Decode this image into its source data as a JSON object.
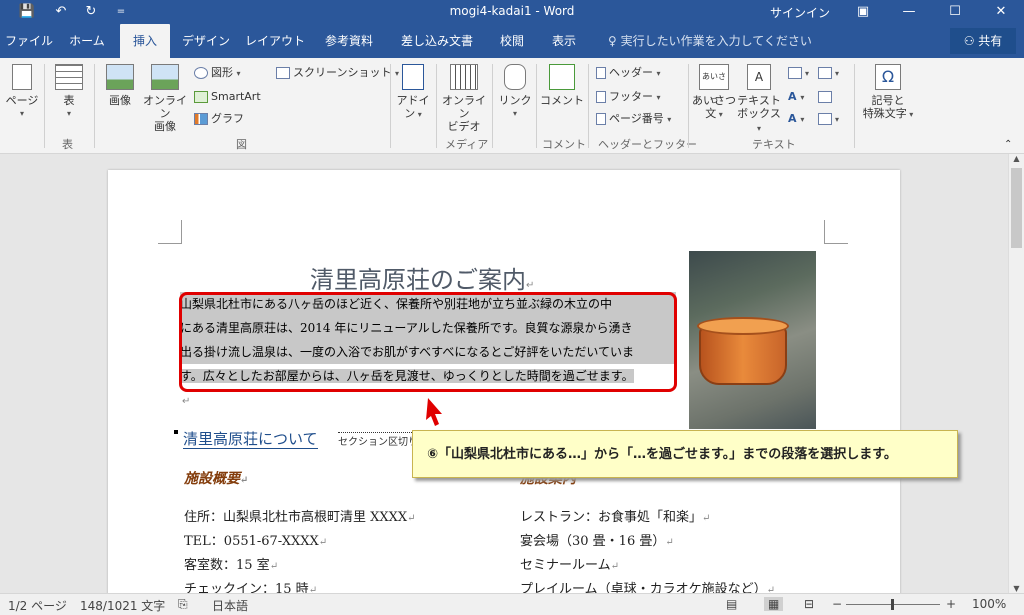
{
  "titlebar": {
    "document_title": "mogi4-kadai1  -  Word",
    "signin": "サインイン",
    "save_icon": "💾",
    "undo_icon": "↶",
    "redo_icon": "↻",
    "customize_icon": "=",
    "ribbon_display_icon": "▣",
    "minimize_icon": "—",
    "maximize_icon": "☐",
    "close_icon": "✕"
  },
  "tabs": [
    "ファイル",
    "ホーム",
    "挿入",
    "デザイン",
    "レイアウト",
    "参考資料",
    "差し込み文書",
    "校閲",
    "表示"
  ],
  "active_tab": "挿入",
  "tellme": "♀ 実行したい作業を入力してください",
  "share": "共有",
  "ribbon": {
    "pages": "ページ",
    "table": "表",
    "picture": "画像",
    "online_picture_1": "オンライン",
    "online_picture_2": "画像",
    "shapes": "図形",
    "smartart": "SmartArt",
    "chart": "グラフ",
    "screenshot": "スクリーンショット",
    "addins_1": "アドイ",
    "addins_2": "ン",
    "online_video_1": "オンライン",
    "online_video_2": "ビデオ",
    "link": "リンク",
    "comment": "コメント",
    "header": "ヘッダー",
    "footer": "フッター",
    "page_number": "ページ番号",
    "greeting_1": "あいさつ",
    "greeting_2": "文",
    "textbox_1": "テキスト",
    "textbox_2": "ボックス",
    "symbol_1": "記号と",
    "symbol_2": "特殊文字",
    "group_tables": "表",
    "group_illustrations": "図",
    "group_media": "メディア",
    "group_comments": "コメント",
    "group_header_footer": "ヘッダーとフッター",
    "group_text": "テキスト"
  },
  "document": {
    "title": "清里高原荘のご案内",
    "paragraph_lines": [
      "山梨県北杜市にある八ヶ岳のほど近く、保養所や別荘地が立ち並ぶ緑の木立の中",
      "にある清里高原荘は、2014 年にリニューアルした保養所です。良質な源泉から湧き",
      "出る掛け流し温泉は、一度の入浴でお肌がすべすべになるとご好評をいただいていま",
      "す。広々としたお部屋からは、八ヶ岳を見渡せ、ゆっくりとした時間を過ごせます。"
    ],
    "section_heading": "清里高原荘について",
    "section_break": "セクション区切り",
    "left_heading": "施設概要",
    "right_heading": "施設案内",
    "left_items": [
      "住所：山梨県北杜市高根町清里 XXXX",
      "TEL：0551-67-XXXX",
      "客室数：15 室",
      "チェックイン：15 時"
    ],
    "right_items": [
      "レストラン：お食事処「和楽」",
      "宴会場（30 畳・16 畳）",
      "セミナールーム",
      "プレイルーム（卓球・カラオケ施設など）"
    ]
  },
  "callout": "⑥「山梨県北杜市にある…」から「…を過ごせます。」までの段落を選択します。",
  "status": {
    "page": "1/2 ページ",
    "words": "148/1021 文字",
    "language": "日本語",
    "zoom": "100%"
  },
  "accent_color": "#2b579a",
  "highlight_color": "#e00000"
}
